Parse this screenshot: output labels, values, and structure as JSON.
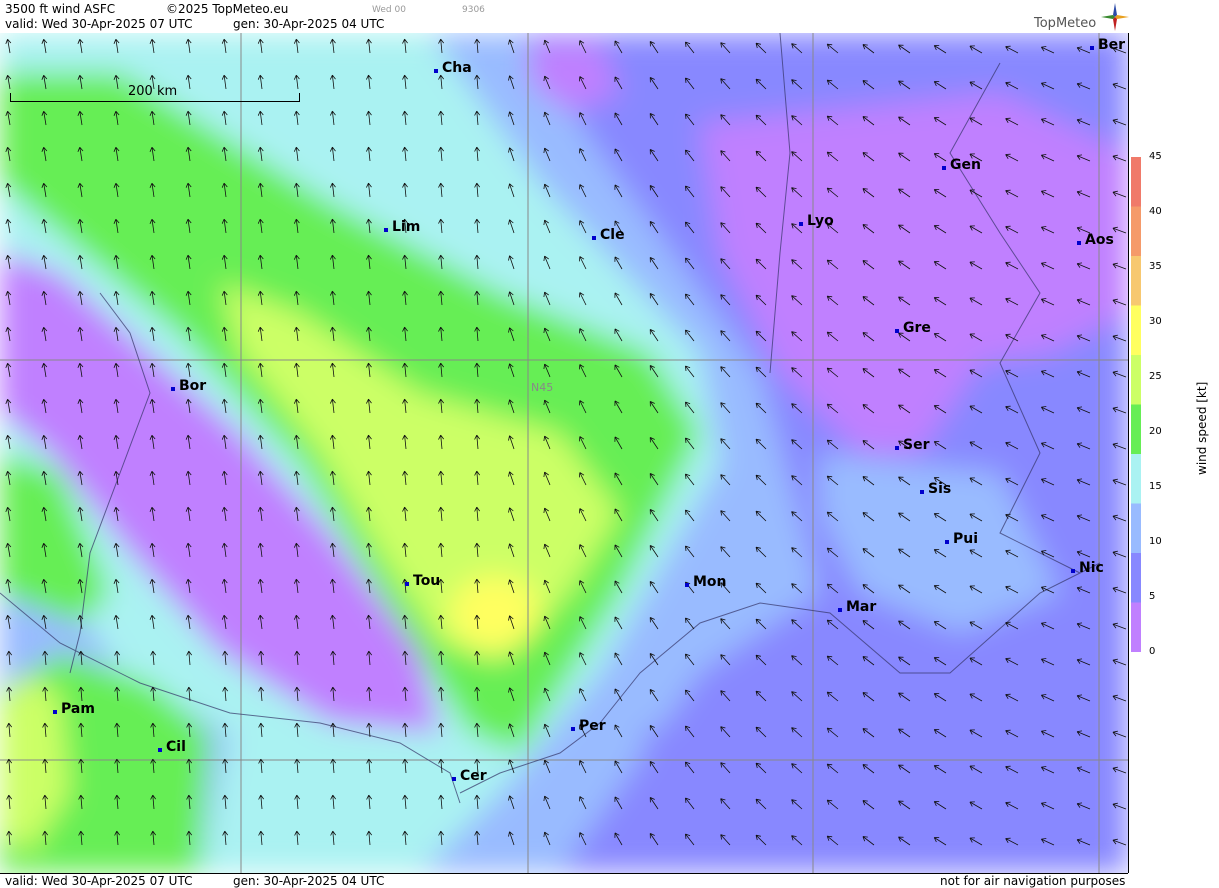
{
  "header": {
    "product": "3500 ft wind ASFC",
    "copyright": "©2025 TopMeteo.eu",
    "valid": "valid:  Wed  30-Apr-2025  07 UTC",
    "gen": "gen: 30-Apr-2025 04 UTC",
    "run_tag": "Wed 00",
    "code": "9306",
    "logo": "TopMeteo"
  },
  "footer": {
    "valid": "valid:  Wed  30-Apr-2025  07 UTC",
    "gen": "gen: 30-Apr-2025 04 UTC",
    "disclaimer": "not for air navigation purposes"
  },
  "map": {
    "scale_label": "200 km",
    "gridline_label": "N45",
    "cities": [
      {
        "name": "Cha"
      },
      {
        "name": "Ber"
      },
      {
        "name": "Lim"
      },
      {
        "name": "Cle"
      },
      {
        "name": "Lyo"
      },
      {
        "name": "Gen"
      },
      {
        "name": "Aos"
      },
      {
        "name": "Gre"
      },
      {
        "name": "Bor"
      },
      {
        "name": "Ser"
      },
      {
        "name": "Sis"
      },
      {
        "name": "Pui"
      },
      {
        "name": "Nic"
      },
      {
        "name": "Tou"
      },
      {
        "name": "Mon"
      },
      {
        "name": "Mar"
      },
      {
        "name": "Per"
      },
      {
        "name": "Pam"
      },
      {
        "name": "Cil"
      },
      {
        "name": "Cer"
      }
    ]
  },
  "legend": {
    "title": "wind speed [kt]",
    "ticks": [
      "45",
      "40",
      "35",
      "30",
      "25",
      "20",
      "15",
      "10",
      "5",
      "0"
    ],
    "colors": [
      "#f07a6a",
      "#f59a6a",
      "#f7c870",
      "#ffff60",
      "#ccff66",
      "#66ee55",
      "#aaf2f2",
      "#99bbff",
      "#8888ff",
      "#c080ff"
    ]
  }
}
